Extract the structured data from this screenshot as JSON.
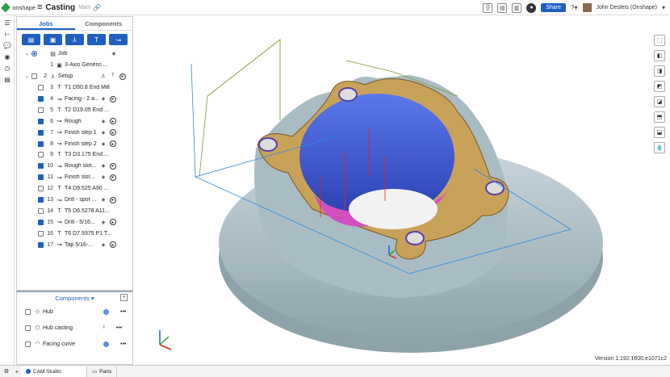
{
  "app": {
    "brand": "onshape",
    "doc_title": "Casting",
    "branch": "Main"
  },
  "top_right": {
    "share": "Share",
    "help": "?",
    "user": "John Deslets (Onshape)"
  },
  "panel": {
    "tabs": [
      "Jobs",
      "Components"
    ],
    "rows": [
      {
        "num": "",
        "label": "Job",
        "checked": false,
        "kind": "job"
      },
      {
        "num": "1",
        "label": "3-Axis Generic ...",
        "checked": false,
        "kind": "machine"
      },
      {
        "num": "2",
        "label": "Setup",
        "checked": false,
        "kind": "setup"
      },
      {
        "num": "3",
        "label": "T1 D50.8 End Mill",
        "checked": false,
        "kind": "tool"
      },
      {
        "num": "4",
        "label": "Facing - 2 a...",
        "checked": true,
        "kind": "op"
      },
      {
        "num": "5",
        "label": "T2 D19.05 End ...",
        "checked": false,
        "kind": "tool"
      },
      {
        "num": "6",
        "label": "Rough",
        "checked": true,
        "kind": "op"
      },
      {
        "num": "7",
        "label": "Finish step 1",
        "checked": true,
        "kind": "op"
      },
      {
        "num": "8",
        "label": "Finish step 2",
        "checked": true,
        "kind": "op"
      },
      {
        "num": "9",
        "label": "T3 D3.175 End ...",
        "checked": false,
        "kind": "tool"
      },
      {
        "num": "10",
        "label": "Rough slot...",
        "checked": true,
        "kind": "op"
      },
      {
        "num": "11",
        "label": "Finish slot...",
        "checked": true,
        "kind": "op"
      },
      {
        "num": "12",
        "label": "T4 D9.525 A90 ...",
        "checked": false,
        "kind": "tool"
      },
      {
        "num": "13",
        "label": "Drill - spot ...",
        "checked": true,
        "kind": "op"
      },
      {
        "num": "14",
        "label": "T5 D6.5278 A11...",
        "checked": false,
        "kind": "tool"
      },
      {
        "num": "15",
        "label": "Drill - 5/16...",
        "checked": true,
        "kind": "op"
      },
      {
        "num": "16",
        "label": "T6 D7.9375 P1 T...",
        "checked": false,
        "kind": "tool"
      },
      {
        "num": "17",
        "label": "Tap 5/16-...",
        "checked": true,
        "kind": "op"
      }
    ]
  },
  "components": {
    "title": "Components",
    "items": [
      "Hub",
      "Hub casting",
      "Facing curve"
    ]
  },
  "viewport": {
    "version": "Version 1.192.1600.e1071c2"
  },
  "bottom": {
    "tabs": [
      "CAM Studio",
      "Parts"
    ]
  },
  "colors": {
    "accent": "#1f5fbf",
    "part": "#b7c6cc",
    "face": "#c9a25a",
    "bore": "#3d5fd8",
    "pocket": "#d24fbf"
  }
}
